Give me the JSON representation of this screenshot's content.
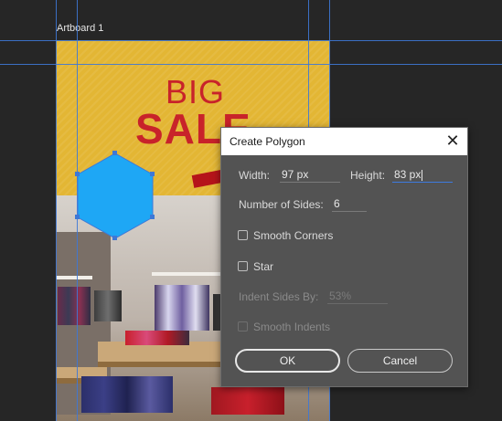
{
  "artboard": {
    "label": "Artboard 1",
    "poster": {
      "headline_top": "BIG",
      "headline_main": "SALE",
      "background_color": "#e3b634",
      "headline_color": "#c8232a"
    }
  },
  "shape": {
    "type": "hexagon",
    "fill_color": "#1ea7f5",
    "selection_color": "#3e78d6"
  },
  "dialog": {
    "title": "Create Polygon",
    "close_icon": "close-icon",
    "width_label": "Width:",
    "width_value": "97 px",
    "height_label": "Height:",
    "height_value": "83 px",
    "sides_label": "Number of Sides:",
    "sides_value": "6",
    "smooth_corners_label": "Smooth Corners",
    "smooth_corners_checked": false,
    "star_label": "Star",
    "star_checked": false,
    "indent_label": "Indent Sides By:",
    "indent_value": "53%",
    "smooth_indents_label": "Smooth Indents",
    "smooth_indents_checked": false,
    "ok_label": "OK",
    "cancel_label": "Cancel"
  }
}
